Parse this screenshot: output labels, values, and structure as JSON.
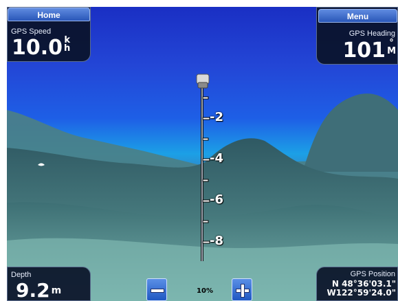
{
  "top_left": {
    "button_label": "Home",
    "label": "GPS Speed",
    "value": "10.0",
    "unit_top": "k",
    "unit_bottom": "h"
  },
  "top_right": {
    "button_label": "Menu",
    "label": "GPS Heading",
    "value": "101",
    "unit_top": "°",
    "unit_bottom": "M"
  },
  "bottom_left": {
    "label": "Depth",
    "value": "9.2",
    "unit": "m"
  },
  "bottom_right": {
    "label": "GPS Position",
    "lat": "N  48°36'03.1\"",
    "lon": "W122°59'24.0\""
  },
  "zoom": {
    "level": "10%"
  },
  "depth_scale": [
    "-2",
    "-4",
    "-6",
    "-8"
  ],
  "colors": {
    "panel_bg": "#0a1228",
    "button_top": "#5f8be0",
    "button_bottom": "#2a57b8",
    "water": "#1e5fe6",
    "terrain": "#5d8f8a"
  }
}
